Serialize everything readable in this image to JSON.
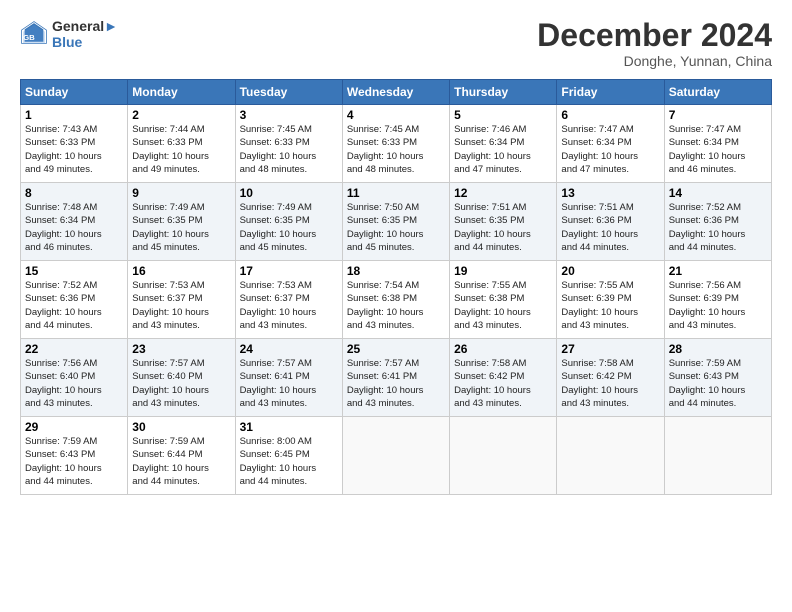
{
  "logo": {
    "line1": "General",
    "line2": "Blue"
  },
  "title": "December 2024",
  "subtitle": "Donghe, Yunnan, China",
  "days_of_week": [
    "Sunday",
    "Monday",
    "Tuesday",
    "Wednesday",
    "Thursday",
    "Friday",
    "Saturday"
  ],
  "weeks": [
    [
      {
        "day": 1,
        "info": "Sunrise: 7:43 AM\nSunset: 6:33 PM\nDaylight: 10 hours\nand 49 minutes."
      },
      {
        "day": 2,
        "info": "Sunrise: 7:44 AM\nSunset: 6:33 PM\nDaylight: 10 hours\nand 49 minutes."
      },
      {
        "day": 3,
        "info": "Sunrise: 7:45 AM\nSunset: 6:33 PM\nDaylight: 10 hours\nand 48 minutes."
      },
      {
        "day": 4,
        "info": "Sunrise: 7:45 AM\nSunset: 6:33 PM\nDaylight: 10 hours\nand 48 minutes."
      },
      {
        "day": 5,
        "info": "Sunrise: 7:46 AM\nSunset: 6:34 PM\nDaylight: 10 hours\nand 47 minutes."
      },
      {
        "day": 6,
        "info": "Sunrise: 7:47 AM\nSunset: 6:34 PM\nDaylight: 10 hours\nand 47 minutes."
      },
      {
        "day": 7,
        "info": "Sunrise: 7:47 AM\nSunset: 6:34 PM\nDaylight: 10 hours\nand 46 minutes."
      }
    ],
    [
      {
        "day": 8,
        "info": "Sunrise: 7:48 AM\nSunset: 6:34 PM\nDaylight: 10 hours\nand 46 minutes."
      },
      {
        "day": 9,
        "info": "Sunrise: 7:49 AM\nSunset: 6:35 PM\nDaylight: 10 hours\nand 45 minutes."
      },
      {
        "day": 10,
        "info": "Sunrise: 7:49 AM\nSunset: 6:35 PM\nDaylight: 10 hours\nand 45 minutes."
      },
      {
        "day": 11,
        "info": "Sunrise: 7:50 AM\nSunset: 6:35 PM\nDaylight: 10 hours\nand 45 minutes."
      },
      {
        "day": 12,
        "info": "Sunrise: 7:51 AM\nSunset: 6:35 PM\nDaylight: 10 hours\nand 44 minutes."
      },
      {
        "day": 13,
        "info": "Sunrise: 7:51 AM\nSunset: 6:36 PM\nDaylight: 10 hours\nand 44 minutes."
      },
      {
        "day": 14,
        "info": "Sunrise: 7:52 AM\nSunset: 6:36 PM\nDaylight: 10 hours\nand 44 minutes."
      }
    ],
    [
      {
        "day": 15,
        "info": "Sunrise: 7:52 AM\nSunset: 6:36 PM\nDaylight: 10 hours\nand 44 minutes."
      },
      {
        "day": 16,
        "info": "Sunrise: 7:53 AM\nSunset: 6:37 PM\nDaylight: 10 hours\nand 43 minutes."
      },
      {
        "day": 17,
        "info": "Sunrise: 7:53 AM\nSunset: 6:37 PM\nDaylight: 10 hours\nand 43 minutes."
      },
      {
        "day": 18,
        "info": "Sunrise: 7:54 AM\nSunset: 6:38 PM\nDaylight: 10 hours\nand 43 minutes."
      },
      {
        "day": 19,
        "info": "Sunrise: 7:55 AM\nSunset: 6:38 PM\nDaylight: 10 hours\nand 43 minutes."
      },
      {
        "day": 20,
        "info": "Sunrise: 7:55 AM\nSunset: 6:39 PM\nDaylight: 10 hours\nand 43 minutes."
      },
      {
        "day": 21,
        "info": "Sunrise: 7:56 AM\nSunset: 6:39 PM\nDaylight: 10 hours\nand 43 minutes."
      }
    ],
    [
      {
        "day": 22,
        "info": "Sunrise: 7:56 AM\nSunset: 6:40 PM\nDaylight: 10 hours\nand 43 minutes."
      },
      {
        "day": 23,
        "info": "Sunrise: 7:57 AM\nSunset: 6:40 PM\nDaylight: 10 hours\nand 43 minutes."
      },
      {
        "day": 24,
        "info": "Sunrise: 7:57 AM\nSunset: 6:41 PM\nDaylight: 10 hours\nand 43 minutes."
      },
      {
        "day": 25,
        "info": "Sunrise: 7:57 AM\nSunset: 6:41 PM\nDaylight: 10 hours\nand 43 minutes."
      },
      {
        "day": 26,
        "info": "Sunrise: 7:58 AM\nSunset: 6:42 PM\nDaylight: 10 hours\nand 43 minutes."
      },
      {
        "day": 27,
        "info": "Sunrise: 7:58 AM\nSunset: 6:42 PM\nDaylight: 10 hours\nand 43 minutes."
      },
      {
        "day": 28,
        "info": "Sunrise: 7:59 AM\nSunset: 6:43 PM\nDaylight: 10 hours\nand 44 minutes."
      }
    ],
    [
      {
        "day": 29,
        "info": "Sunrise: 7:59 AM\nSunset: 6:43 PM\nDaylight: 10 hours\nand 44 minutes."
      },
      {
        "day": 30,
        "info": "Sunrise: 7:59 AM\nSunset: 6:44 PM\nDaylight: 10 hours\nand 44 minutes."
      },
      {
        "day": 31,
        "info": "Sunrise: 8:00 AM\nSunset: 6:45 PM\nDaylight: 10 hours\nand 44 minutes."
      },
      {
        "day": null
      },
      {
        "day": null
      },
      {
        "day": null
      },
      {
        "day": null
      }
    ]
  ]
}
